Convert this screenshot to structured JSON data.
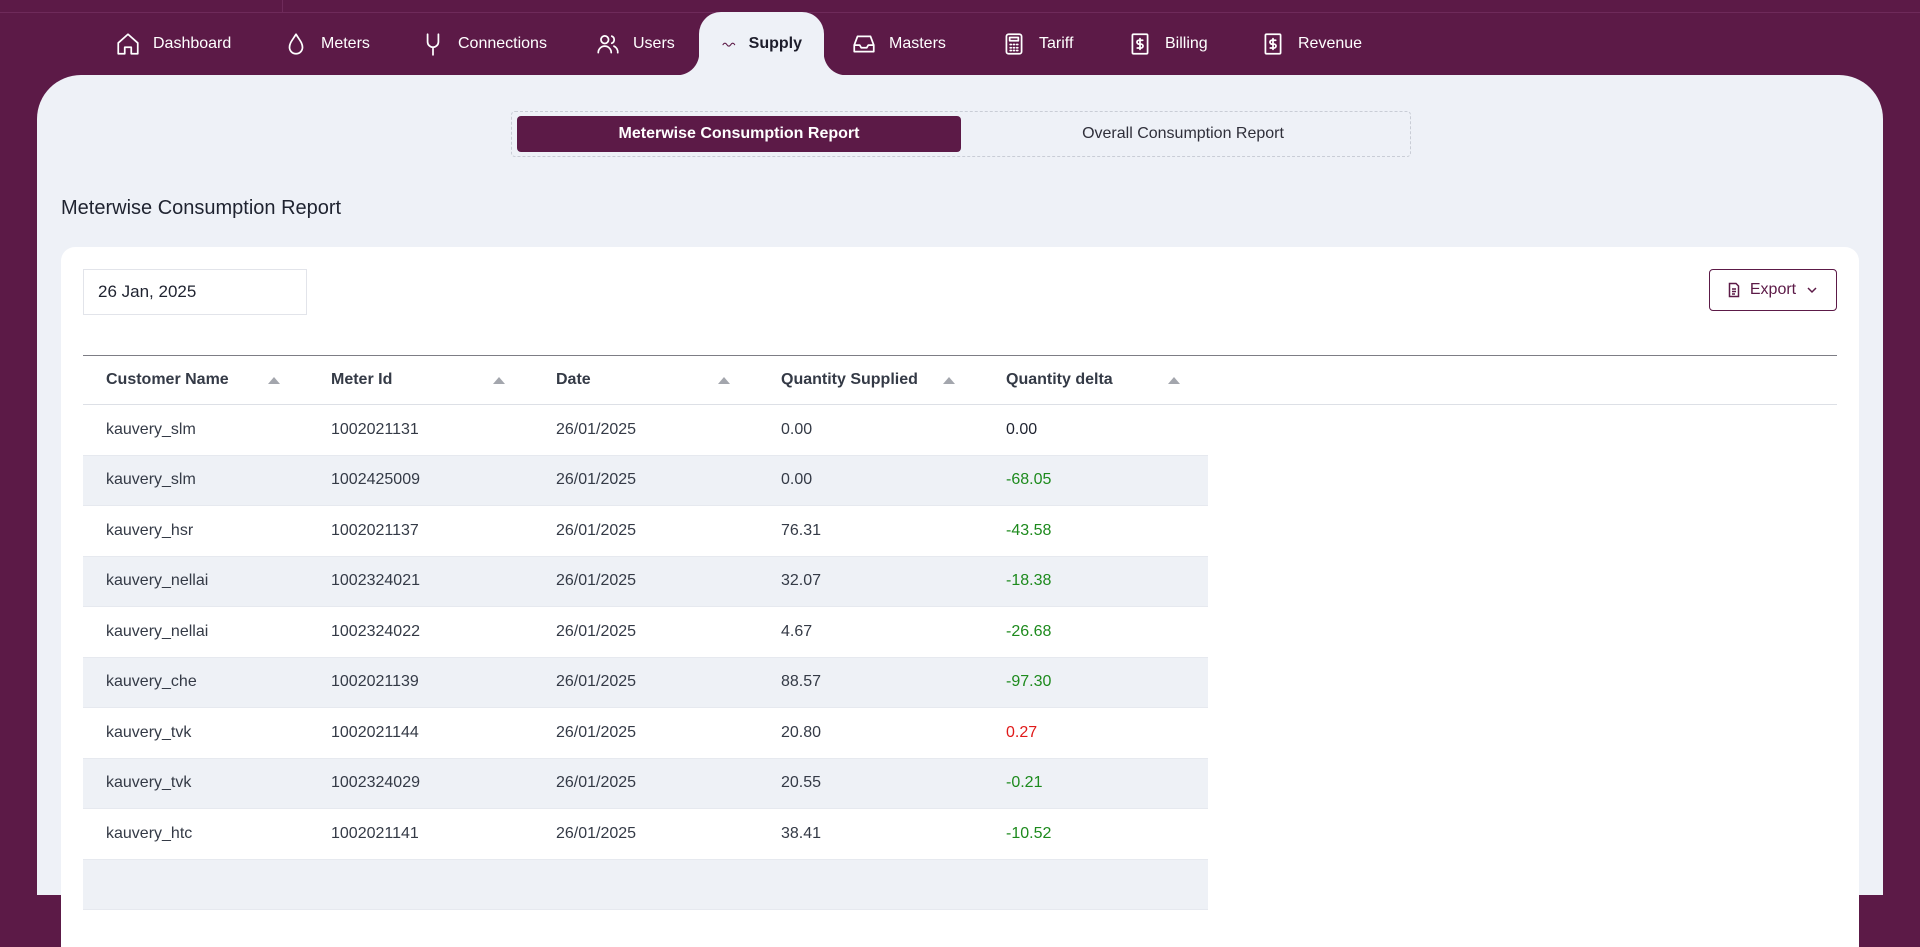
{
  "nav": {
    "items": [
      {
        "label": "Dashboard",
        "icon": "home-icon"
      },
      {
        "label": "Meters",
        "icon": "droplet-icon"
      },
      {
        "label": "Connections",
        "icon": "plug-icon"
      },
      {
        "label": "Users",
        "icon": "users-icon"
      },
      {
        "label": "Supply",
        "icon": "wave-icon",
        "active": true
      },
      {
        "label": "Masters",
        "icon": "inbox-icon"
      },
      {
        "label": "Tariff",
        "icon": "calculator-icon"
      },
      {
        "label": "Billing",
        "icon": "dollar-doc-icon"
      },
      {
        "label": "Revenue",
        "icon": "dollar-doc-icon"
      }
    ]
  },
  "tabs": {
    "active": "Meterwise Consumption Report",
    "inactive": "Overall Consumption Report"
  },
  "page_title": "Meterwise Consumption Report",
  "date_value": "26 Jan, 2025",
  "export_label": "Export",
  "table": {
    "headers": [
      "Customer Name",
      "Meter Id",
      "Date",
      "Quantity Supplied",
      "Quantity delta"
    ],
    "rows": [
      [
        "kauvery_slm",
        "1002021131",
        "26/01/2025",
        "0.00",
        "0.00"
      ],
      [
        "kauvery_slm",
        "1002425009",
        "26/01/2025",
        "0.00",
        "-68.05"
      ],
      [
        "kauvery_hsr",
        "1002021137",
        "26/01/2025",
        "76.31",
        "-43.58"
      ],
      [
        "kauvery_nellai",
        "1002324021",
        "26/01/2025",
        "32.07",
        "-18.38"
      ],
      [
        "kauvery_nellai",
        "1002324022",
        "26/01/2025",
        "4.67",
        "-26.68"
      ],
      [
        "kauvery_che",
        "1002021139",
        "26/01/2025",
        "88.57",
        "-97.30"
      ],
      [
        "kauvery_tvk",
        "1002021144",
        "26/01/2025",
        "20.80",
        "0.27"
      ],
      [
        "kauvery_tvk",
        "1002324029",
        "26/01/2025",
        "20.55",
        "-0.21"
      ],
      [
        "kauvery_htc",
        "1002021141",
        "26/01/2025",
        "38.41",
        "-10.52"
      ]
    ]
  },
  "colors": {
    "brand": "#5c1a47",
    "negative_delta": "#1d8a1d",
    "positive_delta": "#e01a1a"
  }
}
